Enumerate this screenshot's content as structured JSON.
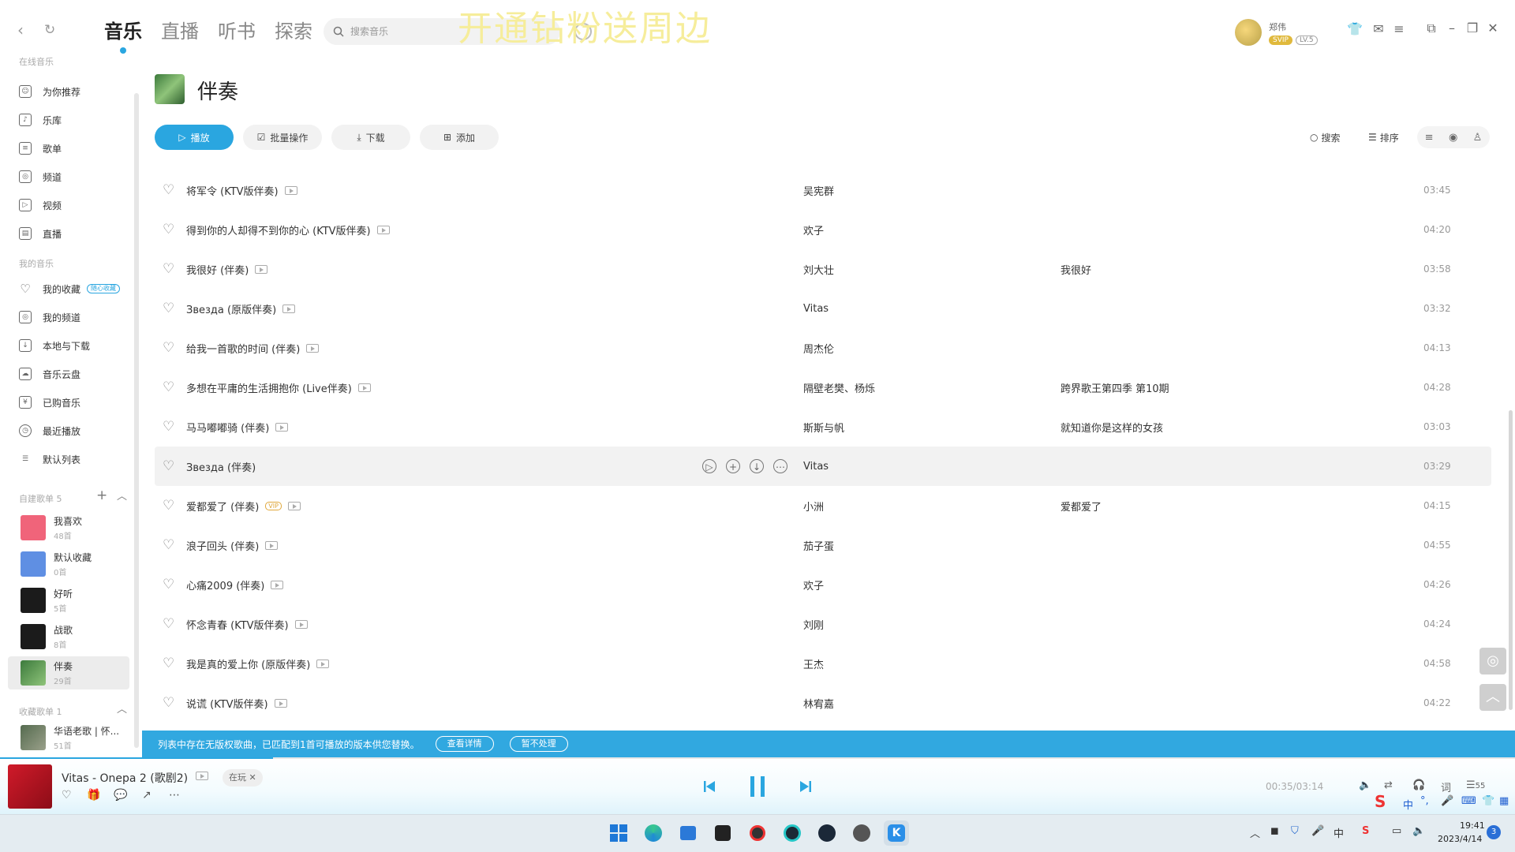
{
  "top": {
    "tabs": [
      "音乐",
      "直播",
      "听书",
      "探索"
    ],
    "search_placeholder": "搜索音乐",
    "promo_text": "开通钻粉送周边",
    "user_name": "郑伟",
    "svip": "SVIP",
    "level": "LV.5"
  },
  "sidebar": {
    "section_top_label": "在线音乐",
    "items": [
      "为你推荐",
      "乐库",
      "歌单",
      "频道",
      "视频",
      "直播"
    ],
    "my_music_label": "我的音乐",
    "my_items": [
      "我的收藏",
      "我的频道",
      "本地与下载",
      "音乐云盘",
      "已购音乐",
      "最近播放",
      "默认列表"
    ],
    "new_badge": "随心收藏",
    "self_playlists_label": "自建歌单 5",
    "playlists": [
      {
        "name": "我喜欢",
        "count": "48首"
      },
      {
        "name": "默认收藏",
        "count": "0首"
      },
      {
        "name": "好听",
        "count": "5首"
      },
      {
        "name": "战歌",
        "count": "8首"
      },
      {
        "name": "伴奏",
        "count": "29首"
      }
    ],
    "collected_label": "收藏歌单 1",
    "collected": [
      {
        "name": "华语老歌 | 怀...",
        "count": "51首"
      }
    ]
  },
  "main": {
    "title": "伴奏",
    "actions": {
      "play": "播放",
      "batch": "批量操作",
      "download": "下载",
      "add": "添加"
    },
    "tools": {
      "search": "搜索",
      "sort": "排序"
    },
    "songs": [
      {
        "title": "将军令 (KTV版伴奏)",
        "artist": "吴宪群",
        "album": "",
        "duration": "03:45"
      },
      {
        "title": "得到你的人却得不到你的心 (KTV版伴奏)",
        "artist": "欢子",
        "album": "",
        "duration": "04:20"
      },
      {
        "title": "我很好 (伴奏)",
        "artist": "刘大壮",
        "album": "我很好",
        "duration": "03:58"
      },
      {
        "title": "Звезда (原版伴奏)",
        "artist": "Vitas",
        "album": "",
        "duration": "03:32"
      },
      {
        "title": "给我一首歌的时间 (伴奏)",
        "artist": "周杰伦",
        "album": "",
        "duration": "04:13"
      },
      {
        "title": "多想在平庸的生活拥抱你 (Live伴奏)",
        "artist": "隔壁老樊、杨烁",
        "album": "跨界歌王第四季 第10期",
        "duration": "04:28"
      },
      {
        "title": "马马嘟嘟骑 (伴奏)",
        "artist": "斯斯与帆",
        "album": "就知道你是这样的女孩",
        "duration": "03:03"
      },
      {
        "title": "Звезда (伴奏)",
        "artist": "Vitas",
        "album": "",
        "duration": "03:29"
      },
      {
        "title": "爱都爱了 (伴奏)",
        "artist": "小洲",
        "album": "爱都爱了",
        "duration": "04:15"
      },
      {
        "title": "浪子回头 (伴奏)",
        "artist": "茄子蛋",
        "album": "",
        "duration": "04:55"
      },
      {
        "title": "心痛2009 (伴奏)",
        "artist": "欢子",
        "album": "",
        "duration": "04:26"
      },
      {
        "title": "怀念青春 (KTV版伴奏)",
        "artist": "刘刚",
        "album": "",
        "duration": "04:24"
      },
      {
        "title": "我是真的爱上你 (原版伴奏)",
        "artist": "王杰",
        "album": "",
        "duration": "04:58"
      },
      {
        "title": "说谎 (KTV版伴奏)",
        "artist": "林宥嘉",
        "album": "",
        "duration": "04:22"
      }
    ],
    "vip_badge": "VIP"
  },
  "notice": {
    "text": "列表中存在无版权歌曲，已匹配到1首可播放的版本供您替换。",
    "details": "查看详情",
    "ignore": "暂不处理"
  },
  "player": {
    "now_playing": "Vitas - Onepa 2 (歌剧2)",
    "chip": "在玩",
    "time": "00:35/03:14",
    "progress_fraction": 0.18,
    "lyric_btn": "词",
    "count": "55"
  },
  "taskbar": {
    "time": "19:41",
    "date": "2023/4/14",
    "notifications": "3",
    "ime": "中"
  },
  "colors": {
    "accent": "#2aa6e0",
    "notice": "#31a8e0"
  }
}
